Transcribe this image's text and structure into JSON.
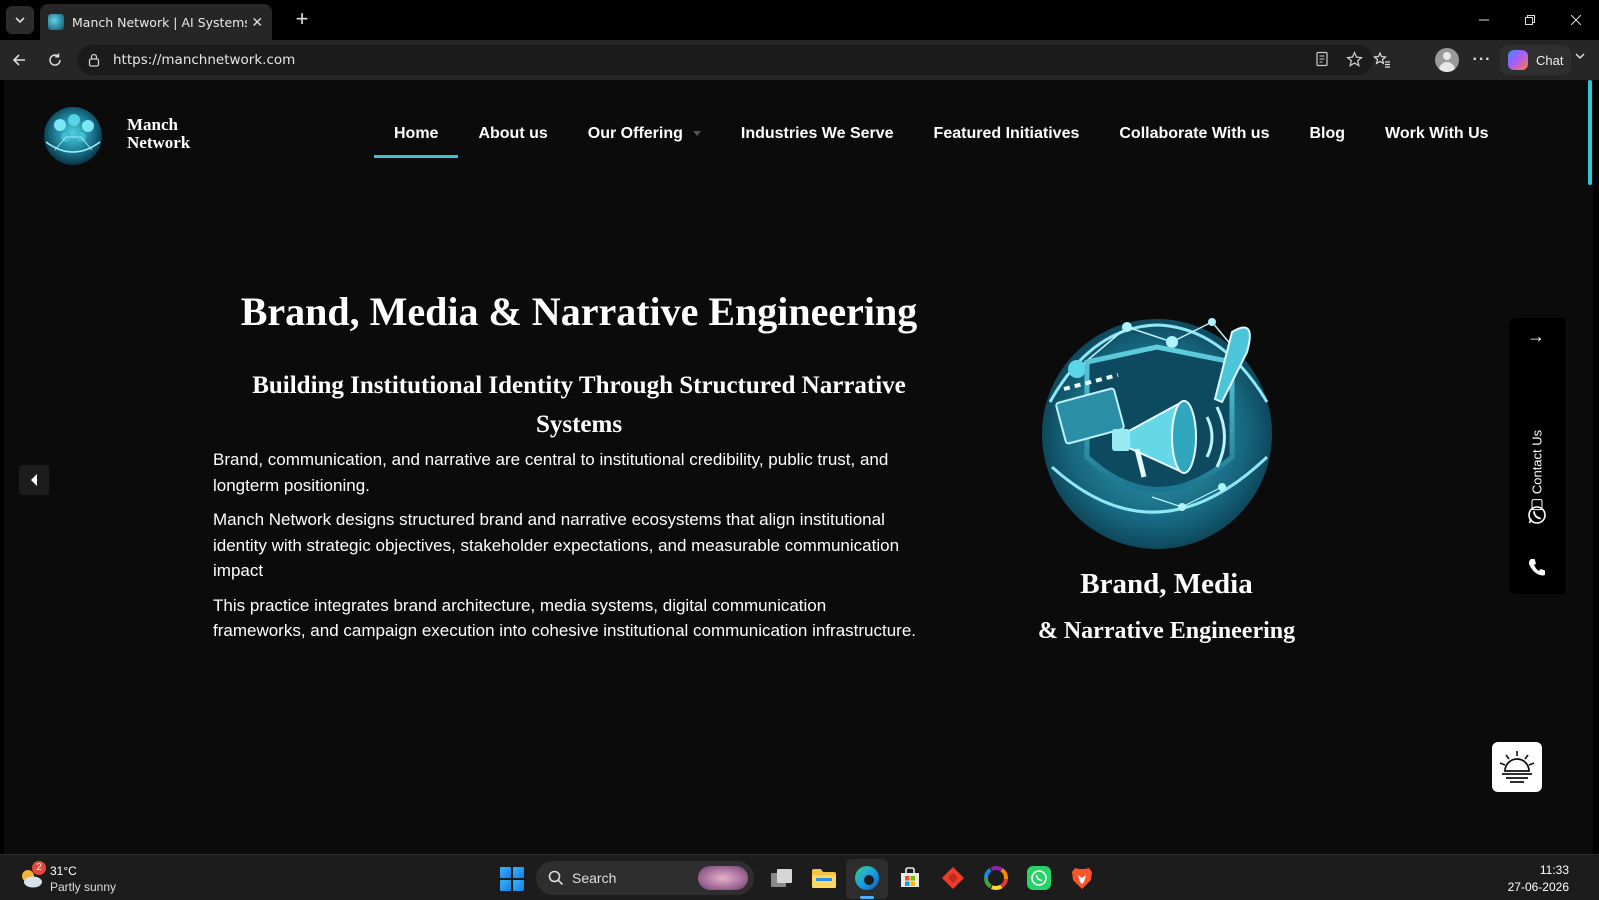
{
  "browser": {
    "tab_title": "Manch Network | AI Systems & Digital",
    "url": "https://manchnetwork.com",
    "chat_label": "Chat"
  },
  "site": {
    "brand_line1": "Manch",
    "brand_line2": "Network",
    "menu": [
      {
        "label": "Home",
        "active": true
      },
      {
        "label": "About us"
      },
      {
        "label": "Our Offering",
        "has_dropdown": true
      },
      {
        "label": "Industries We Serve"
      },
      {
        "label": "Featured Initiatives"
      },
      {
        "label": "Collaborate With us"
      },
      {
        "label": "Blog"
      },
      {
        "label": "Work With Us"
      }
    ],
    "accent_color": "#37c5d4"
  },
  "hero": {
    "title": "Brand, Media & Narrative Engineering",
    "subtitle": "Building Institutional Identity Through Structured Narrative Systems",
    "paragraphs": [
      "Brand, communication, and narrative are central to institutional credibility, public trust, and longterm positioning.",
      "Manch Network designs structured brand and narrative ecosystems that align institutional identity with strategic objectives, stakeholder expectations, and measurable communication impact",
      "This practice integrates brand architecture, media systems, digital communication frameworks, and campaign execution into cohesive institutional communication infrastructure."
    ],
    "side_caption_line1": "Brand, Media",
    "side_caption_line2": "& Narrative Engineering"
  },
  "contact_panel": {
    "label": "Contact Us",
    "icons": [
      "arrow-right-icon",
      "whatsapp-icon",
      "phone-icon"
    ]
  },
  "taskbar": {
    "weather_temp": "31°C",
    "weather_desc": "Partly sunny",
    "weather_badge": "2",
    "search_label": "Search",
    "time": "11:33",
    "date": "27-06-2026"
  }
}
